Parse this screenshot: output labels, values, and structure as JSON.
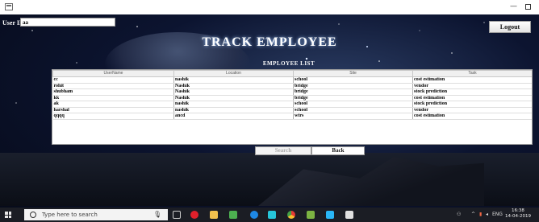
{
  "window": {
    "minimize_glyph": "—",
    "close_glyph": "⊡"
  },
  "header": {
    "user_id_label": "User ID",
    "user_id_value": "aa",
    "logout_label": "Logout",
    "title": "TRACK EMPLOYEE"
  },
  "employee_list": {
    "title": "EMPLOYEE  LIST",
    "columns": [
      "UserName",
      "Location",
      "Site",
      "Task"
    ],
    "rows": [
      [
        "cc",
        "nashik",
        "school",
        "cost estimation"
      ],
      [
        "rohit",
        "Nashik",
        "bridge",
        "vendor"
      ],
      [
        "shubham",
        "Nashik",
        "bridge",
        "stock prediction"
      ],
      [
        "kk",
        "Nashik",
        "bridge",
        "cost estimation"
      ],
      [
        "ak",
        "nashik",
        "school",
        "stock prediction"
      ],
      [
        "harshal",
        "nashik",
        "school",
        "vendor"
      ],
      [
        "qqqq",
        "ancd",
        "wtrs",
        "cost estimation"
      ]
    ]
  },
  "actions": {
    "search_label": "Search",
    "back_label": "Back"
  },
  "taskbar": {
    "search_placeholder": "Type here to search",
    "language": "ENG",
    "time": "16:38",
    "date": "14-04-2019",
    "icons": [
      "task-view-icon",
      "opera-icon",
      "file-explorer-icon",
      "store-icon",
      "edge-icon",
      "chrome-icon",
      "app-icon-7",
      "app-icon-8",
      "app-icon-9"
    ]
  }
}
